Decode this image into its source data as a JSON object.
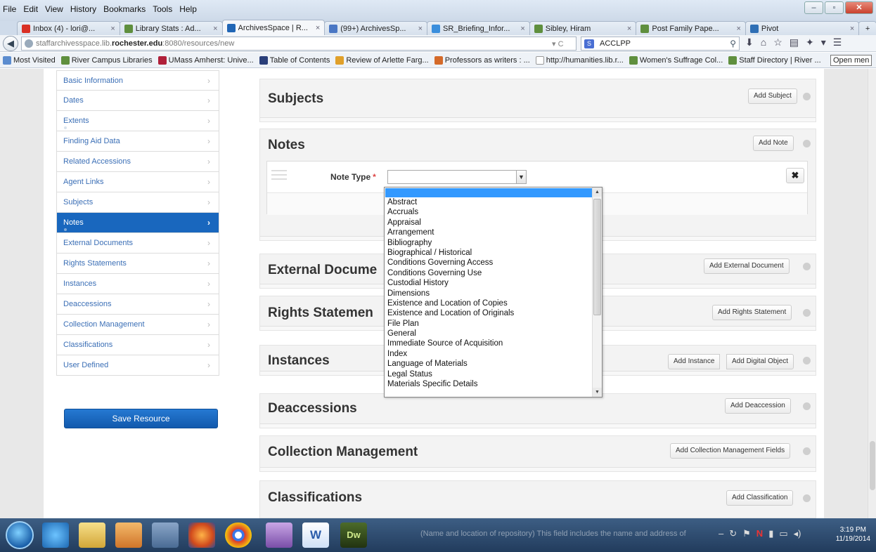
{
  "browser": {
    "menu": [
      "File",
      "Edit",
      "View",
      "History",
      "Bookmarks",
      "Tools",
      "Help"
    ],
    "tabs": [
      {
        "label": "Inbox (4) - lori@...",
        "color": "#d93025"
      },
      {
        "label": "Library Stats : Ad...",
        "color": "#5f8f3e"
      },
      {
        "label": "ArchivesSpace | R...",
        "color": "#2166b5"
      },
      {
        "label": "(99+) ArchivesSp...",
        "color": "#4a77c4"
      },
      {
        "label": "SR_Briefing_Infor...",
        "color": "#3a8edc"
      },
      {
        "label": "Sibley, Hiram",
        "color": "#5f8f3e"
      },
      {
        "label": "Post Family Pape...",
        "color": "#5f8f3e"
      },
      {
        "label": "Pivot",
        "color": "#2f6fb5"
      }
    ],
    "url_prefix": "staffarchivesspace.lib.",
    "url_domain": "rochester.edu",
    "url_suffix": ":8080/resources/new",
    "search_engine_label": "S",
    "search_text": "ACCLPP",
    "open_menu_tip": "Open men",
    "bookmarks": [
      {
        "label": "Most Visited",
        "color": "#5b8ccf"
      },
      {
        "label": "River Campus Libraries",
        "color": "#5f8f3e"
      },
      {
        "label": "UMass Amherst: Unive...",
        "color": "#b0203a"
      },
      {
        "label": "Table of Contents",
        "color": "#2a3f7a"
      },
      {
        "label": "Review of Arlette Farg...",
        "color": "#e0a02a"
      },
      {
        "label": "Professors as writers : ...",
        "color": "#d46a2a"
      },
      {
        "label": "http://humanities.lib.r...",
        "color": "#ffffff"
      },
      {
        "label": "Women's Suffrage Col...",
        "color": "#5f8f3e"
      },
      {
        "label": "Staff Directory | River ...",
        "color": "#5f8f3e"
      }
    ]
  },
  "sidebar": {
    "items": [
      {
        "label": "Basic Information",
        "active": false,
        "dot": false
      },
      {
        "label": "Dates",
        "active": false,
        "dot": false
      },
      {
        "label": "Extents",
        "active": false,
        "dot": true
      },
      {
        "label": "Finding Aid Data",
        "active": false,
        "dot": false
      },
      {
        "label": "Related Accessions",
        "active": false,
        "dot": false
      },
      {
        "label": "Agent Links",
        "active": false,
        "dot": false
      },
      {
        "label": "Subjects",
        "active": false,
        "dot": false
      },
      {
        "label": "Notes",
        "active": true,
        "dot": true
      },
      {
        "label": "External Documents",
        "active": false,
        "dot": false
      },
      {
        "label": "Rights Statements",
        "active": false,
        "dot": false
      },
      {
        "label": "Instances",
        "active": false,
        "dot": false
      },
      {
        "label": "Deaccessions",
        "active": false,
        "dot": false
      },
      {
        "label": "Collection Management",
        "active": false,
        "dot": false
      },
      {
        "label": "Classifications",
        "active": false,
        "dot": false
      },
      {
        "label": "User Defined",
        "active": false,
        "dot": false
      }
    ],
    "save_label": "Save Resource"
  },
  "sections": {
    "subjects": {
      "title": "Subjects",
      "button": "Add Subject"
    },
    "notes": {
      "title": "Notes",
      "button": "Add Note"
    },
    "external": {
      "title": "External Docume",
      "button": "Add External Document"
    },
    "rights": {
      "title": "Rights Statemen",
      "button": "Add Rights Statement"
    },
    "instances": {
      "title": "Instances",
      "button": "Add Instance",
      "button2": "Add Digital Object"
    },
    "deaccessions": {
      "title": "Deaccessions",
      "button": "Add Deaccession"
    },
    "collection": {
      "title": "Collection Management",
      "button": "Add Collection Management Fields"
    },
    "classifications": {
      "title": "Classifications",
      "button": "Add Classification"
    }
  },
  "note_form": {
    "label": "Note Type",
    "required_mark": "*",
    "remove_glyph": "✖",
    "options": [
      "Abstract",
      "Accruals",
      "Appraisal",
      "Arrangement",
      "Bibliography",
      "Biographical / Historical",
      "Conditions Governing Access",
      "Conditions Governing Use",
      "Custodial History",
      "Dimensions",
      "Existence and Location of Copies",
      "Existence and Location of Originals",
      "File Plan",
      "General",
      "Immediate Source of Acquisition",
      "Index",
      "Language of Materials",
      "Legal Status",
      "Materials Specific Details"
    ]
  },
  "taskbar": {
    "background_text": "(Name and location of repository) This field includes the name and address of",
    "dw_label": "Dw",
    "word_label": "W",
    "tray_n": "N",
    "time": "3:19 PM",
    "date": "11/19/2014"
  }
}
